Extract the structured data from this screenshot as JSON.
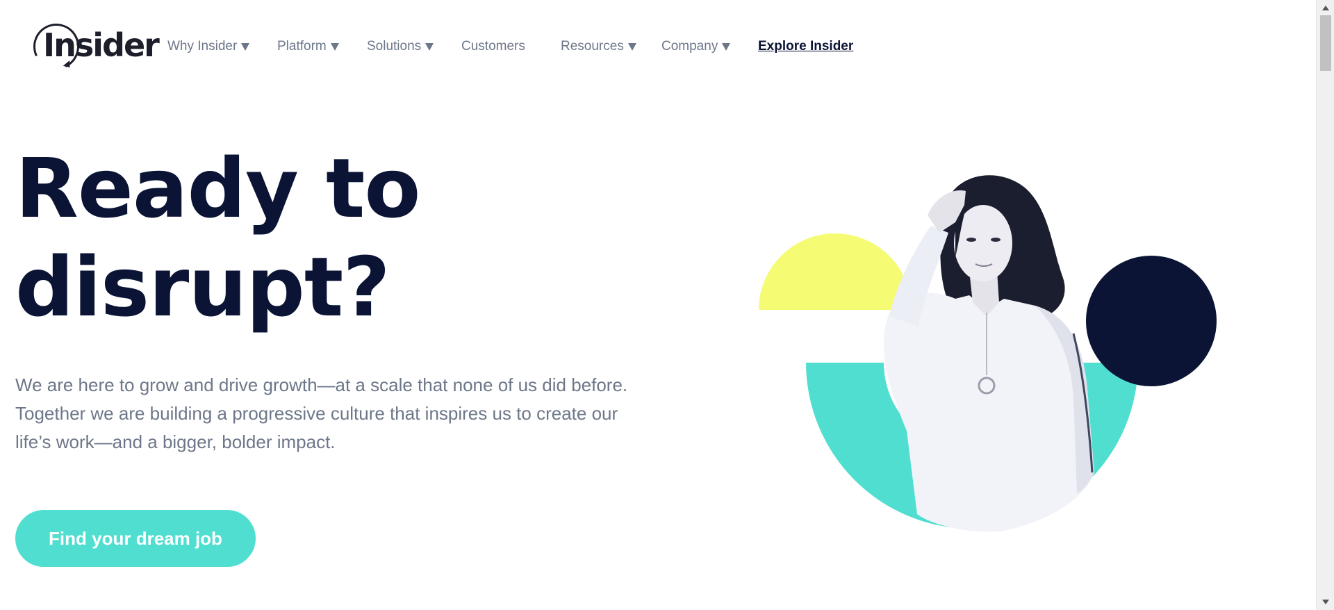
{
  "brand": {
    "logo_text": "Insider",
    "accent": "#4fdecf",
    "navy": "#0b1434",
    "yellow": "#f5fc73"
  },
  "nav": {
    "items": [
      {
        "label": "Why Insider",
        "dropdown": true
      },
      {
        "label": "Platform",
        "dropdown": true
      },
      {
        "label": "Solutions",
        "dropdown": true
      },
      {
        "label": "Customers",
        "dropdown": false
      },
      {
        "label": "Resources",
        "dropdown": true
      },
      {
        "label": "Company",
        "dropdown": true
      }
    ],
    "explore": "Explore Insider"
  },
  "hero": {
    "title_line1": "Ready to",
    "title_line2": "disrupt?",
    "description": "We are here to grow and drive growth—at a scale that none of us did before. Together we are building a progressive culture that inspires us to create our life’s work—and a bigger, bolder impact.",
    "cta": "Find your dream job"
  }
}
